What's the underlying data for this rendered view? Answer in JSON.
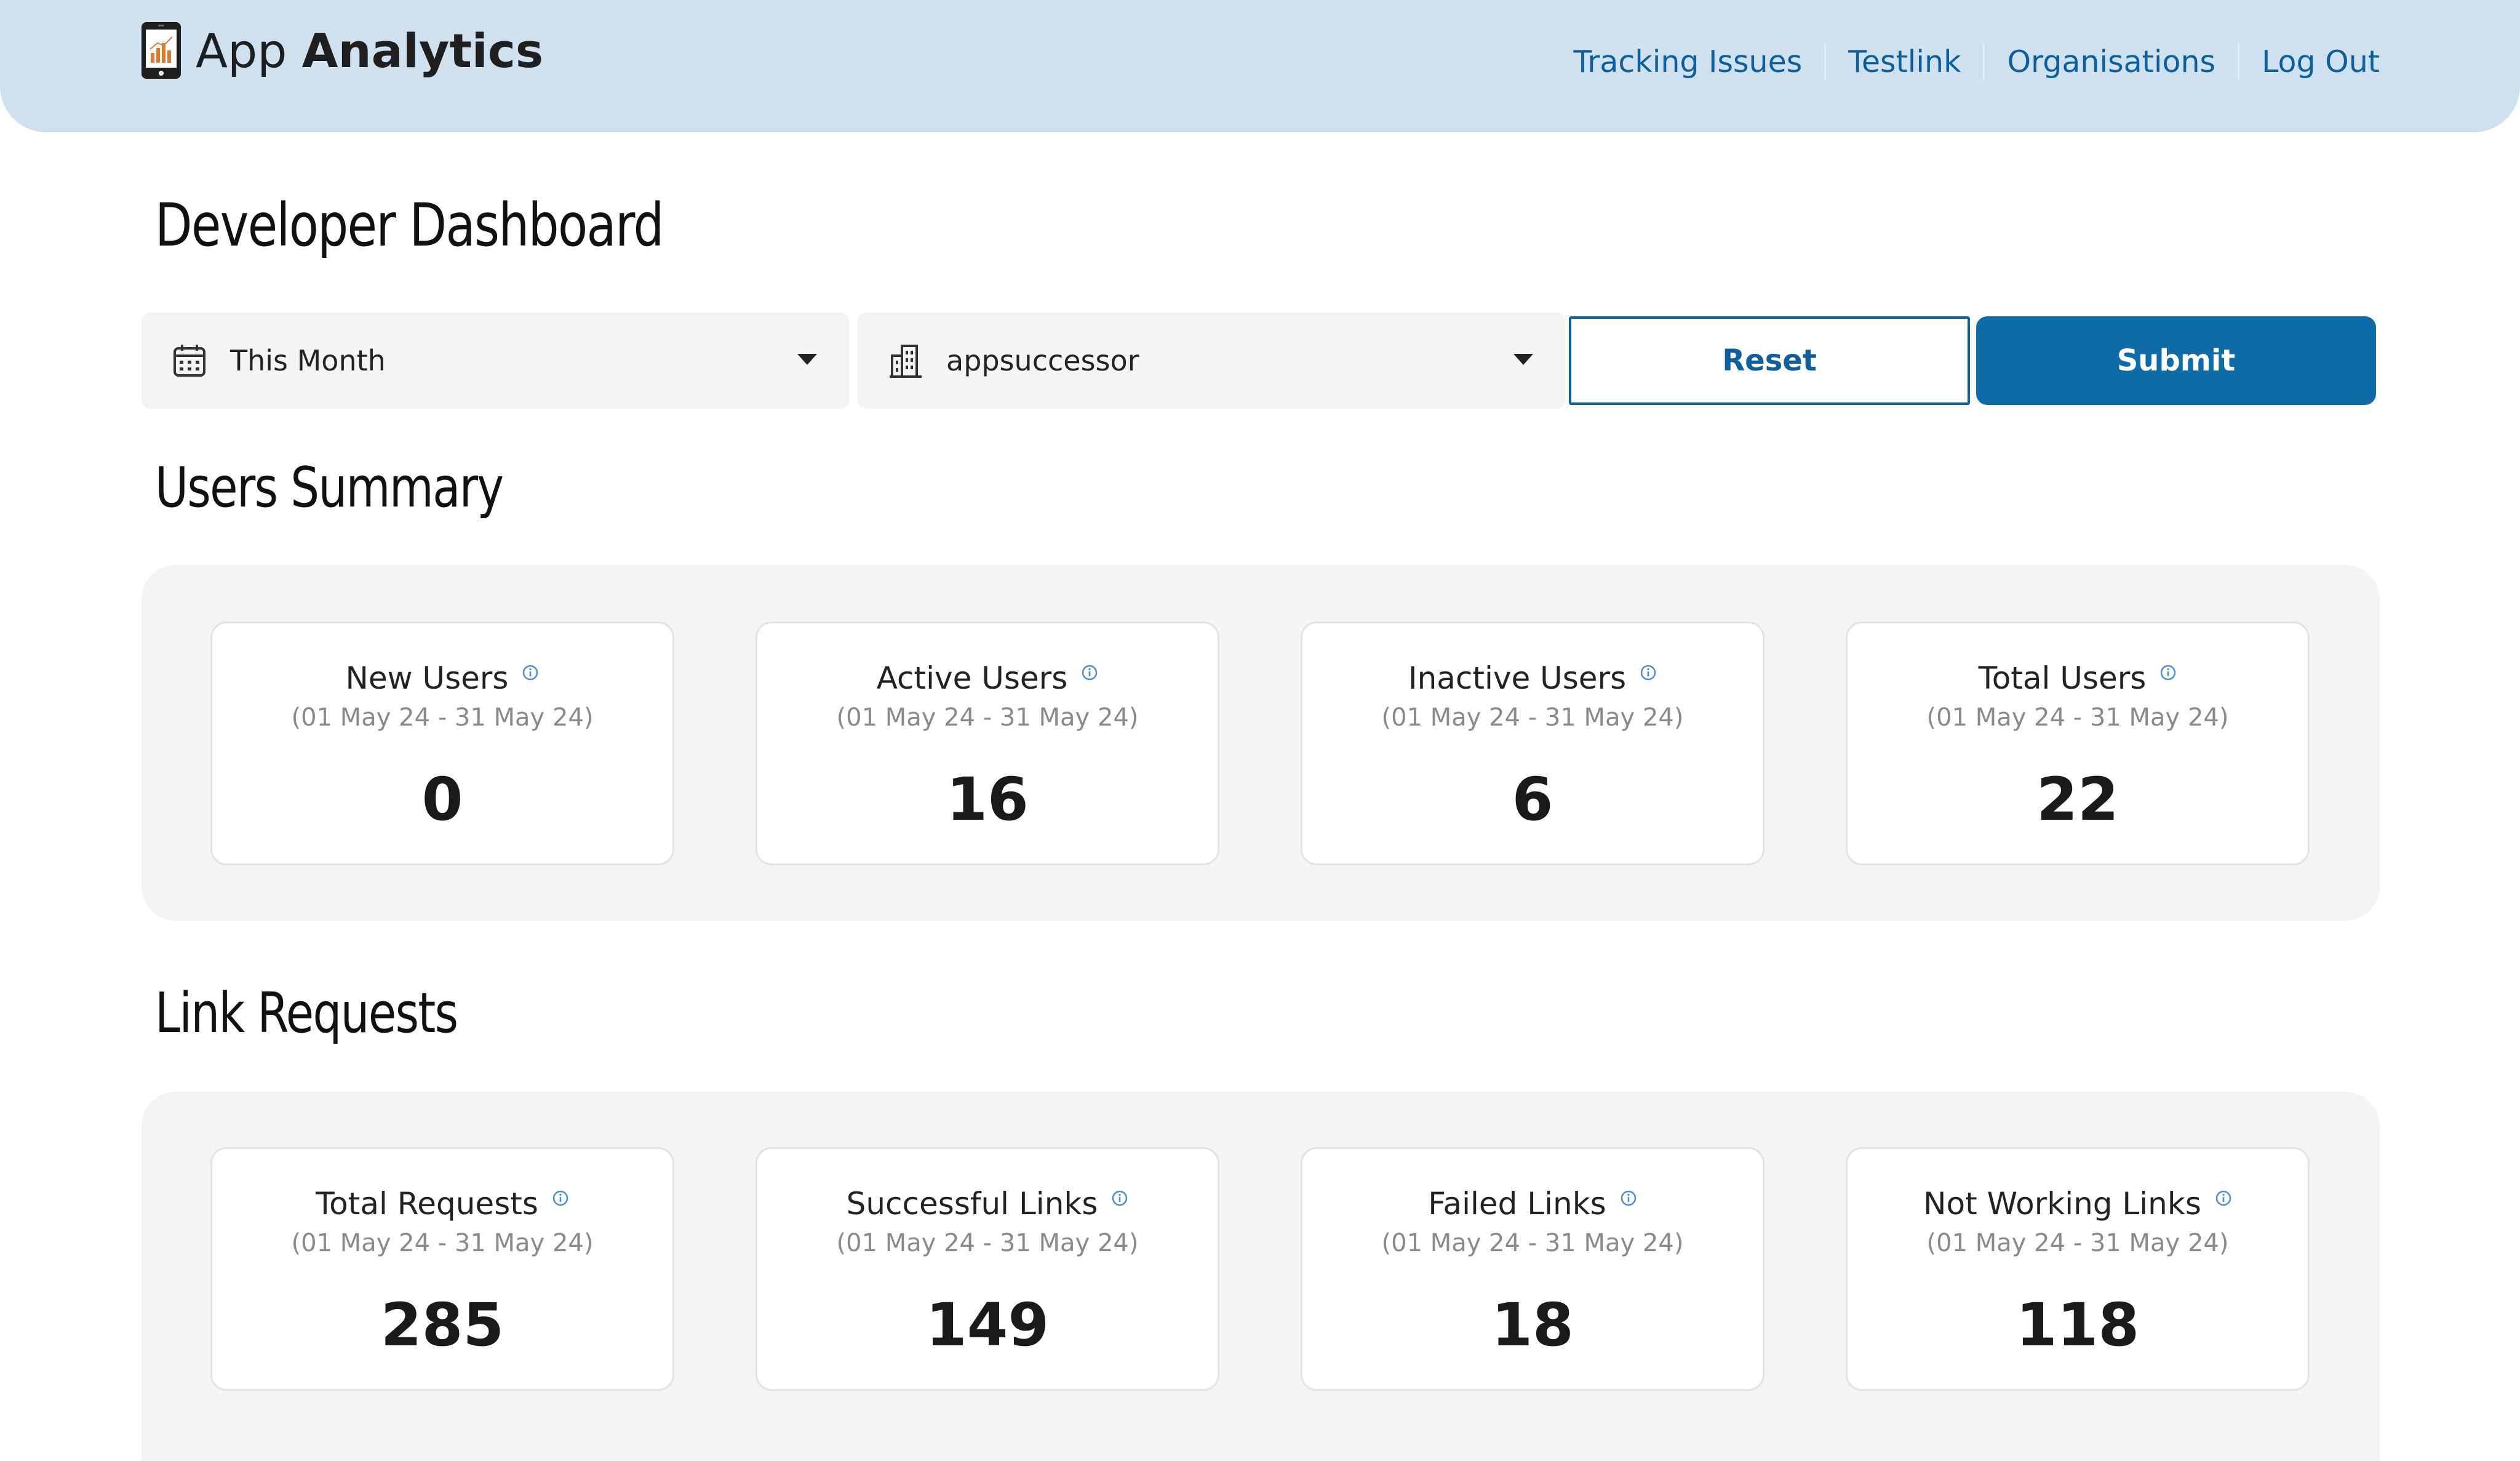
{
  "app": {
    "title_prefix": "App",
    "title_bold": "Analytics",
    "logo_icon": "phone-chart-icon"
  },
  "nav": {
    "items": [
      "Tracking Issues",
      "Testlink",
      "Organisations",
      "Log Out"
    ]
  },
  "page_title": "Developer Dashboard",
  "filters": {
    "date_range": {
      "value": "This Month",
      "icon": "calendar-icon"
    },
    "organisation": {
      "value": "appsuccessor",
      "icon": "building-icon"
    },
    "reset_label": "Reset",
    "submit_label": "Submit"
  },
  "users_summary": {
    "title": "Users Summary",
    "cards": [
      {
        "label": "New Users",
        "range": "(01 May 24 - 31 May 24)",
        "value": "0"
      },
      {
        "label": "Active Users",
        "range": "(01 May 24 - 31 May 24)",
        "value": "16"
      },
      {
        "label": "Inactive Users",
        "range": "(01 May 24 - 31 May 24)",
        "value": "6"
      },
      {
        "label": "Total Users",
        "range": "(01 May 24 - 31 May 24)",
        "value": "22"
      }
    ]
  },
  "link_requests": {
    "title": "Link Requests",
    "cards": [
      {
        "label": "Total Requests",
        "range": "(01 May 24 - 31 May 24)",
        "value": "285"
      },
      {
        "label": "Successful Links",
        "range": "(01 May 24 - 31 May 24)",
        "value": "149"
      },
      {
        "label": "Failed Links",
        "range": "(01 May 24 - 31 May 24)",
        "value": "18"
      },
      {
        "label": "Not Working Links",
        "range": "(01 May 24 - 31 May 24)",
        "value": "118"
      }
    ]
  },
  "colors": {
    "header_bg": "#cfe0ee",
    "nav_link": "#0d5fa0",
    "primary": "#0f6aa8",
    "panel_bg": "#f4f4f4",
    "info_icon": "#4a8fd0"
  }
}
